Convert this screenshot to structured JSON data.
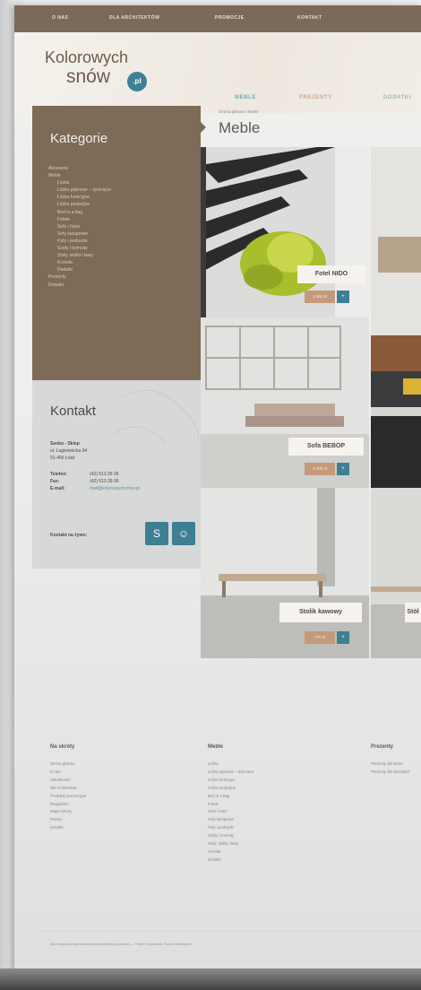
{
  "topbar": {
    "links": [
      "O NAS",
      "DLA ARCHITEKTÓW",
      "PROMOCJE",
      "KONTAKT"
    ]
  },
  "logo": {
    "line1": "Kolorowych",
    "line2": "snów",
    "badge": ".pl"
  },
  "main_nav": [
    "MEBLE",
    "PREZENTY",
    "DODATKI"
  ],
  "sidebar": {
    "title": "Kategorie",
    "items": [
      {
        "label": "Akcesoria",
        "sub": false
      },
      {
        "label": "Meble",
        "sub": false
      },
      {
        "label": "Łóżka",
        "sub": true
      },
      {
        "label": "Łóżka piętrowe – dziecięce",
        "sub": true
      },
      {
        "label": "Łóżka funkcyjne",
        "sub": true
      },
      {
        "label": "Łóżka podwójne",
        "sub": true
      },
      {
        "label": "Bed in a bag",
        "sub": true
      },
      {
        "label": "Fotele",
        "sub": true
      },
      {
        "label": "Sofa i futon",
        "sub": true
      },
      {
        "label": "Sofy kanapowe",
        "sub": true
      },
      {
        "label": "Pufy i poduszki",
        "sub": true
      },
      {
        "label": "Szafy i komody",
        "sub": true
      },
      {
        "label": "Stoły, stoliki i ławy",
        "sub": true
      },
      {
        "label": "Krzesła",
        "sub": true
      },
      {
        "label": "Dodatki",
        "sub": true
      },
      {
        "label": "Prezenty",
        "sub": false
      },
      {
        "label": "Dodatki",
        "sub": false
      }
    ]
  },
  "contact": {
    "title": "Kontakt",
    "company": "Senko - Sklep",
    "street": "ul. Łagiewnicka 94",
    "city": "91-456 Łódź",
    "phone_label": "Telefon:",
    "phone": "(42) 613 26 06",
    "fax_label": "Fax:",
    "fax": "(42) 613 26 06",
    "email_label": "E-mail:",
    "email": "mail@kolorowychsnow.pl",
    "live_label": "Kontakt na żywo:"
  },
  "breadcrumb": "Strona główna / Meble",
  "page_title": "Meble",
  "products": [
    {
      "name": "Fotel NIDO",
      "price": "1 580 zł"
    },
    {
      "name": "Sofa BEBOP",
      "price": "3 000 zł"
    },
    {
      "name": "Stolik kawowy",
      "price": "770 zł"
    },
    {
      "name": "Stół",
      "price": ""
    }
  ],
  "footer": {
    "col1": {
      "title": "Na skróty",
      "items": [
        "Strona główna",
        "O nas",
        "Aktualności",
        "Dla Architektów",
        "Produkty promocyjne",
        "Regulamin",
        "Mapa Strony",
        "Pomoc",
        "Kontakt"
      ]
    },
    "col2": {
      "title": "Meble",
      "items": [
        "Łóżka",
        "Łóżka piętrowe – dziecięce",
        "Łóżka funkcyjne",
        "Łóżka podwójne",
        "Bed in a bag",
        "Fotele",
        "Sofa i futon",
        "Sofy kanapowe",
        "Pufy i poduszki",
        "Szafy i komody",
        "Stoły, stoliki i ławy",
        "Krzesła",
        "Dodatki"
      ]
    },
    "col3": {
      "title": "Prezenty",
      "items": [
        "Prezenty dla dzieci",
        "Prezenty dla dorosłych"
      ]
    },
    "bottom_text": "http://www.kolorowychsnow.pl/strona/polityka-prywatnosci — Projekt i wykonanie: Studio Interaktywne"
  },
  "colors": {
    "brown": "#7d6a57",
    "teal": "#3e7f94",
    "price": "#c49a7a"
  }
}
